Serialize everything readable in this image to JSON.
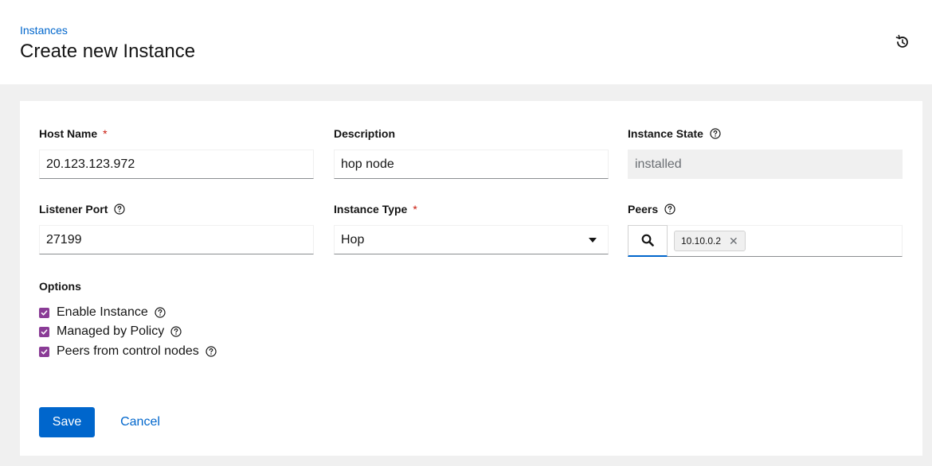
{
  "header": {
    "breadcrumb": "Instances",
    "title": "Create new Instance",
    "history_icon": "history-icon"
  },
  "form": {
    "host_name": {
      "label": "Host Name",
      "required_mark": "*",
      "value": "20.123.123.972"
    },
    "description": {
      "label": "Description",
      "value": "hop node"
    },
    "instance_state": {
      "label": "Instance State",
      "value": "installed"
    },
    "listener_port": {
      "label": "Listener Port",
      "value": "27199"
    },
    "instance_type": {
      "label": "Instance Type",
      "required_mark": "*",
      "value": "Hop"
    },
    "peers": {
      "label": "Peers",
      "chips": [
        "10.10.0.2"
      ]
    },
    "options": {
      "label": "Options",
      "items": [
        {
          "label": "Enable Instance",
          "checked": true
        },
        {
          "label": "Managed by Policy",
          "checked": true
        },
        {
          "label": "Peers from control nodes",
          "checked": true
        }
      ]
    }
  },
  "actions": {
    "save_label": "Save",
    "cancel_label": "Cancel"
  },
  "colors": {
    "primary": "#0066cc",
    "checkbox": "#8a3c96",
    "required": "#c9190b"
  }
}
